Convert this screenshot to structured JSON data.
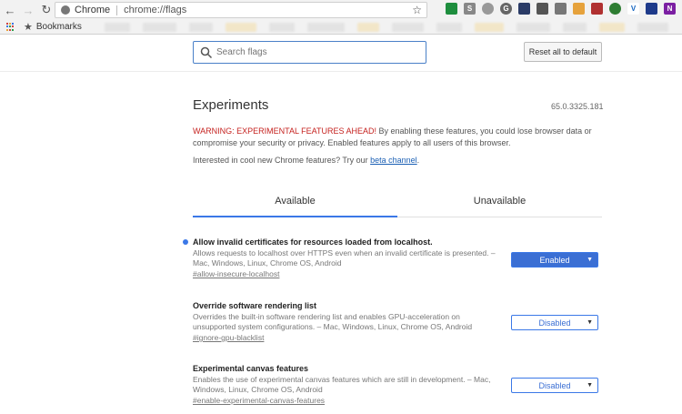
{
  "browser": {
    "site_name": "Chrome",
    "url": "chrome://flags",
    "bookmarks_label": "Bookmarks"
  },
  "search": {
    "placeholder": "Search flags"
  },
  "reset_button": "Reset all to default",
  "page": {
    "title": "Experiments",
    "version": "65.0.3325.181",
    "warning_red": "WARNING: EXPERIMENTAL FEATURES AHEAD!",
    "warning_text": " By enabling these features, you could lose browser data or compromise your security or privacy. Enabled features apply to all users of this browser.",
    "interest_text": "Interested in cool new Chrome features? Try our ",
    "interest_link": "beta channel",
    "interest_end": "."
  },
  "tabs": {
    "available": "Available",
    "unavailable": "Unavailable"
  },
  "flags": [
    {
      "title": "Allow invalid certificates for resources loaded from localhost.",
      "description": "Allows requests to localhost over HTTPS even when an invalid certificate is presented. – Mac, Windows, Linux, Chrome OS, Android",
      "link": "#allow-insecure-localhost",
      "state": "Enabled"
    },
    {
      "title": "Override software rendering list",
      "description": "Overrides the built-in software rendering list and enables GPU-acceleration on unsupported system configurations. – Mac, Windows, Linux, Chrome OS, Android",
      "link": "#ignore-gpu-blacklist",
      "state": "Disabled"
    },
    {
      "title": "Experimental canvas features",
      "description": "Enables the use of experimental canvas features which are still in development. – Mac, Windows, Linux, Chrome OS, Android",
      "link": "#enable-experimental-canvas-features",
      "state": "Disabled"
    }
  ],
  "colors": {
    "accent": "#3b78e7",
    "warning": "#c5221f",
    "enabled_bg": "#3b6fd4"
  },
  "icons": [
    "back-icon",
    "forward-icon",
    "reload-icon",
    "star-icon",
    "apps-icon",
    "search-icon",
    "dropdown-arrow-icon"
  ]
}
